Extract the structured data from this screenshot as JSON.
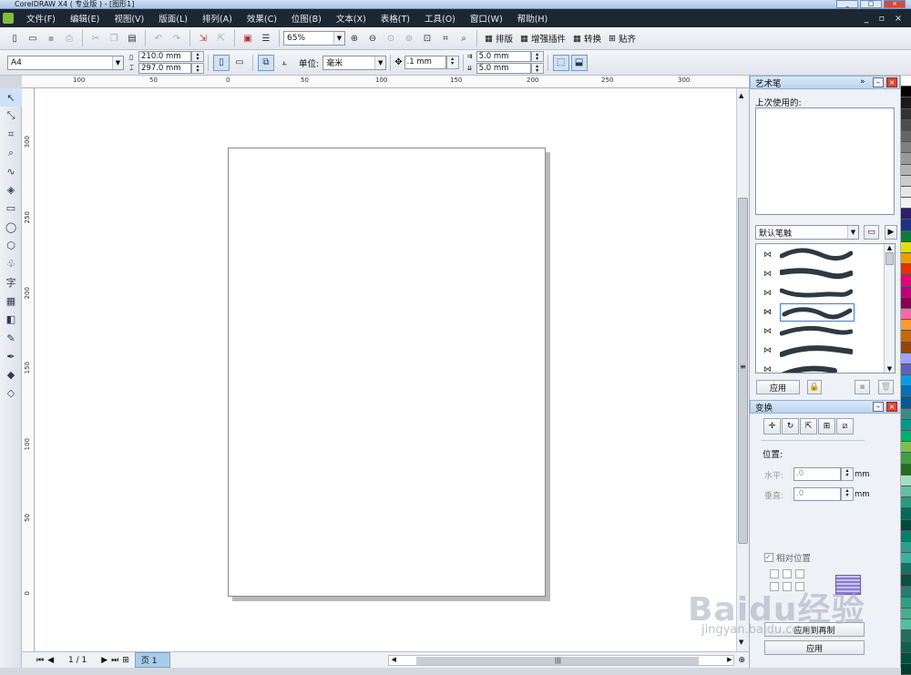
{
  "window": {
    "title": "CorelDRAW X4 ( 专业版 ) - [图形1]"
  },
  "menu": [
    "文件(F)",
    "编辑(E)",
    "视图(V)",
    "版面(L)",
    "排列(A)",
    "效果(C)",
    "位图(B)",
    "文本(X)",
    "表格(T)",
    "工具(O)",
    "窗口(W)",
    "帮助(H)"
  ],
  "toolbar": {
    "zoom": "65%",
    "plugins": [
      {
        "label": "排版"
      },
      {
        "label": "增强插件"
      },
      {
        "label": "转换"
      },
      {
        "label": "贴齐"
      }
    ]
  },
  "propbar": {
    "paper": "A4",
    "width": "210.0 mm",
    "height": "297.0 mm",
    "unit_label": "单位:",
    "unit": "毫米",
    "nudge": ".1 mm",
    "dup_x": "5.0 mm",
    "dup_y": "5.0 mm"
  },
  "rulers": {
    "top": [
      "100",
      "50",
      "0",
      "50",
      "100",
      "150",
      "200",
      "250",
      "300"
    ],
    "left": [
      "300",
      "250",
      "200",
      "150",
      "100",
      "50",
      "0"
    ]
  },
  "docker_artpen": {
    "title": "艺术笔",
    "recent_label": "上次使用的:",
    "brush_set": "默认笔触",
    "apply": "应用"
  },
  "docker_transform": {
    "title": "变换",
    "position_label": "位置:",
    "h_label": "水平:",
    "h_value": ".0",
    "v_label": "垂直:",
    "v_value": ".0",
    "unit": "mm",
    "relative": "相对位置",
    "apply_copy": "应用到再制",
    "apply": "应用"
  },
  "status": {
    "page_counter": "1 / 1",
    "page_tab": "页 1"
  },
  "watermark": {
    "main": "Baidu经验",
    "sub": "jingyan.baidu.com"
  },
  "palette_colors": [
    "#ffffff",
    "#000000",
    "#1a1a1a",
    "#333333",
    "#4d4d4d",
    "#666666",
    "#808080",
    "#999999",
    "#b3b3b3",
    "#cccccc",
    "#e6e6e6",
    "#f2f2f2",
    "#2e1f6b",
    "#1f2f8a",
    "#0b7a3a",
    "#e0e000",
    "#e8a000",
    "#e83000",
    "#e8007a",
    "#c0007a",
    "#8a0050",
    "#ff66aa",
    "#ff9933",
    "#cc6600",
    "#994400",
    "#a0a0ff",
    "#6060c0",
    "#00a0e0",
    "#0070c0",
    "#005a9a",
    "#3a8a8a",
    "#009a8a",
    "#00b070",
    "#80c040",
    "#40a040",
    "#207020",
    "#a0e0c0",
    "#60c0a0",
    "#2a9a7a",
    "#006a5a",
    "#004a3a",
    "#00806a",
    "#2aa090",
    "#3ab0a0",
    "#1a7060",
    "#0a5040",
    "#208070",
    "#30a080",
    "#40b090",
    "#50c0a0",
    "#207060",
    "#106050",
    "#005040",
    "#004030"
  ]
}
